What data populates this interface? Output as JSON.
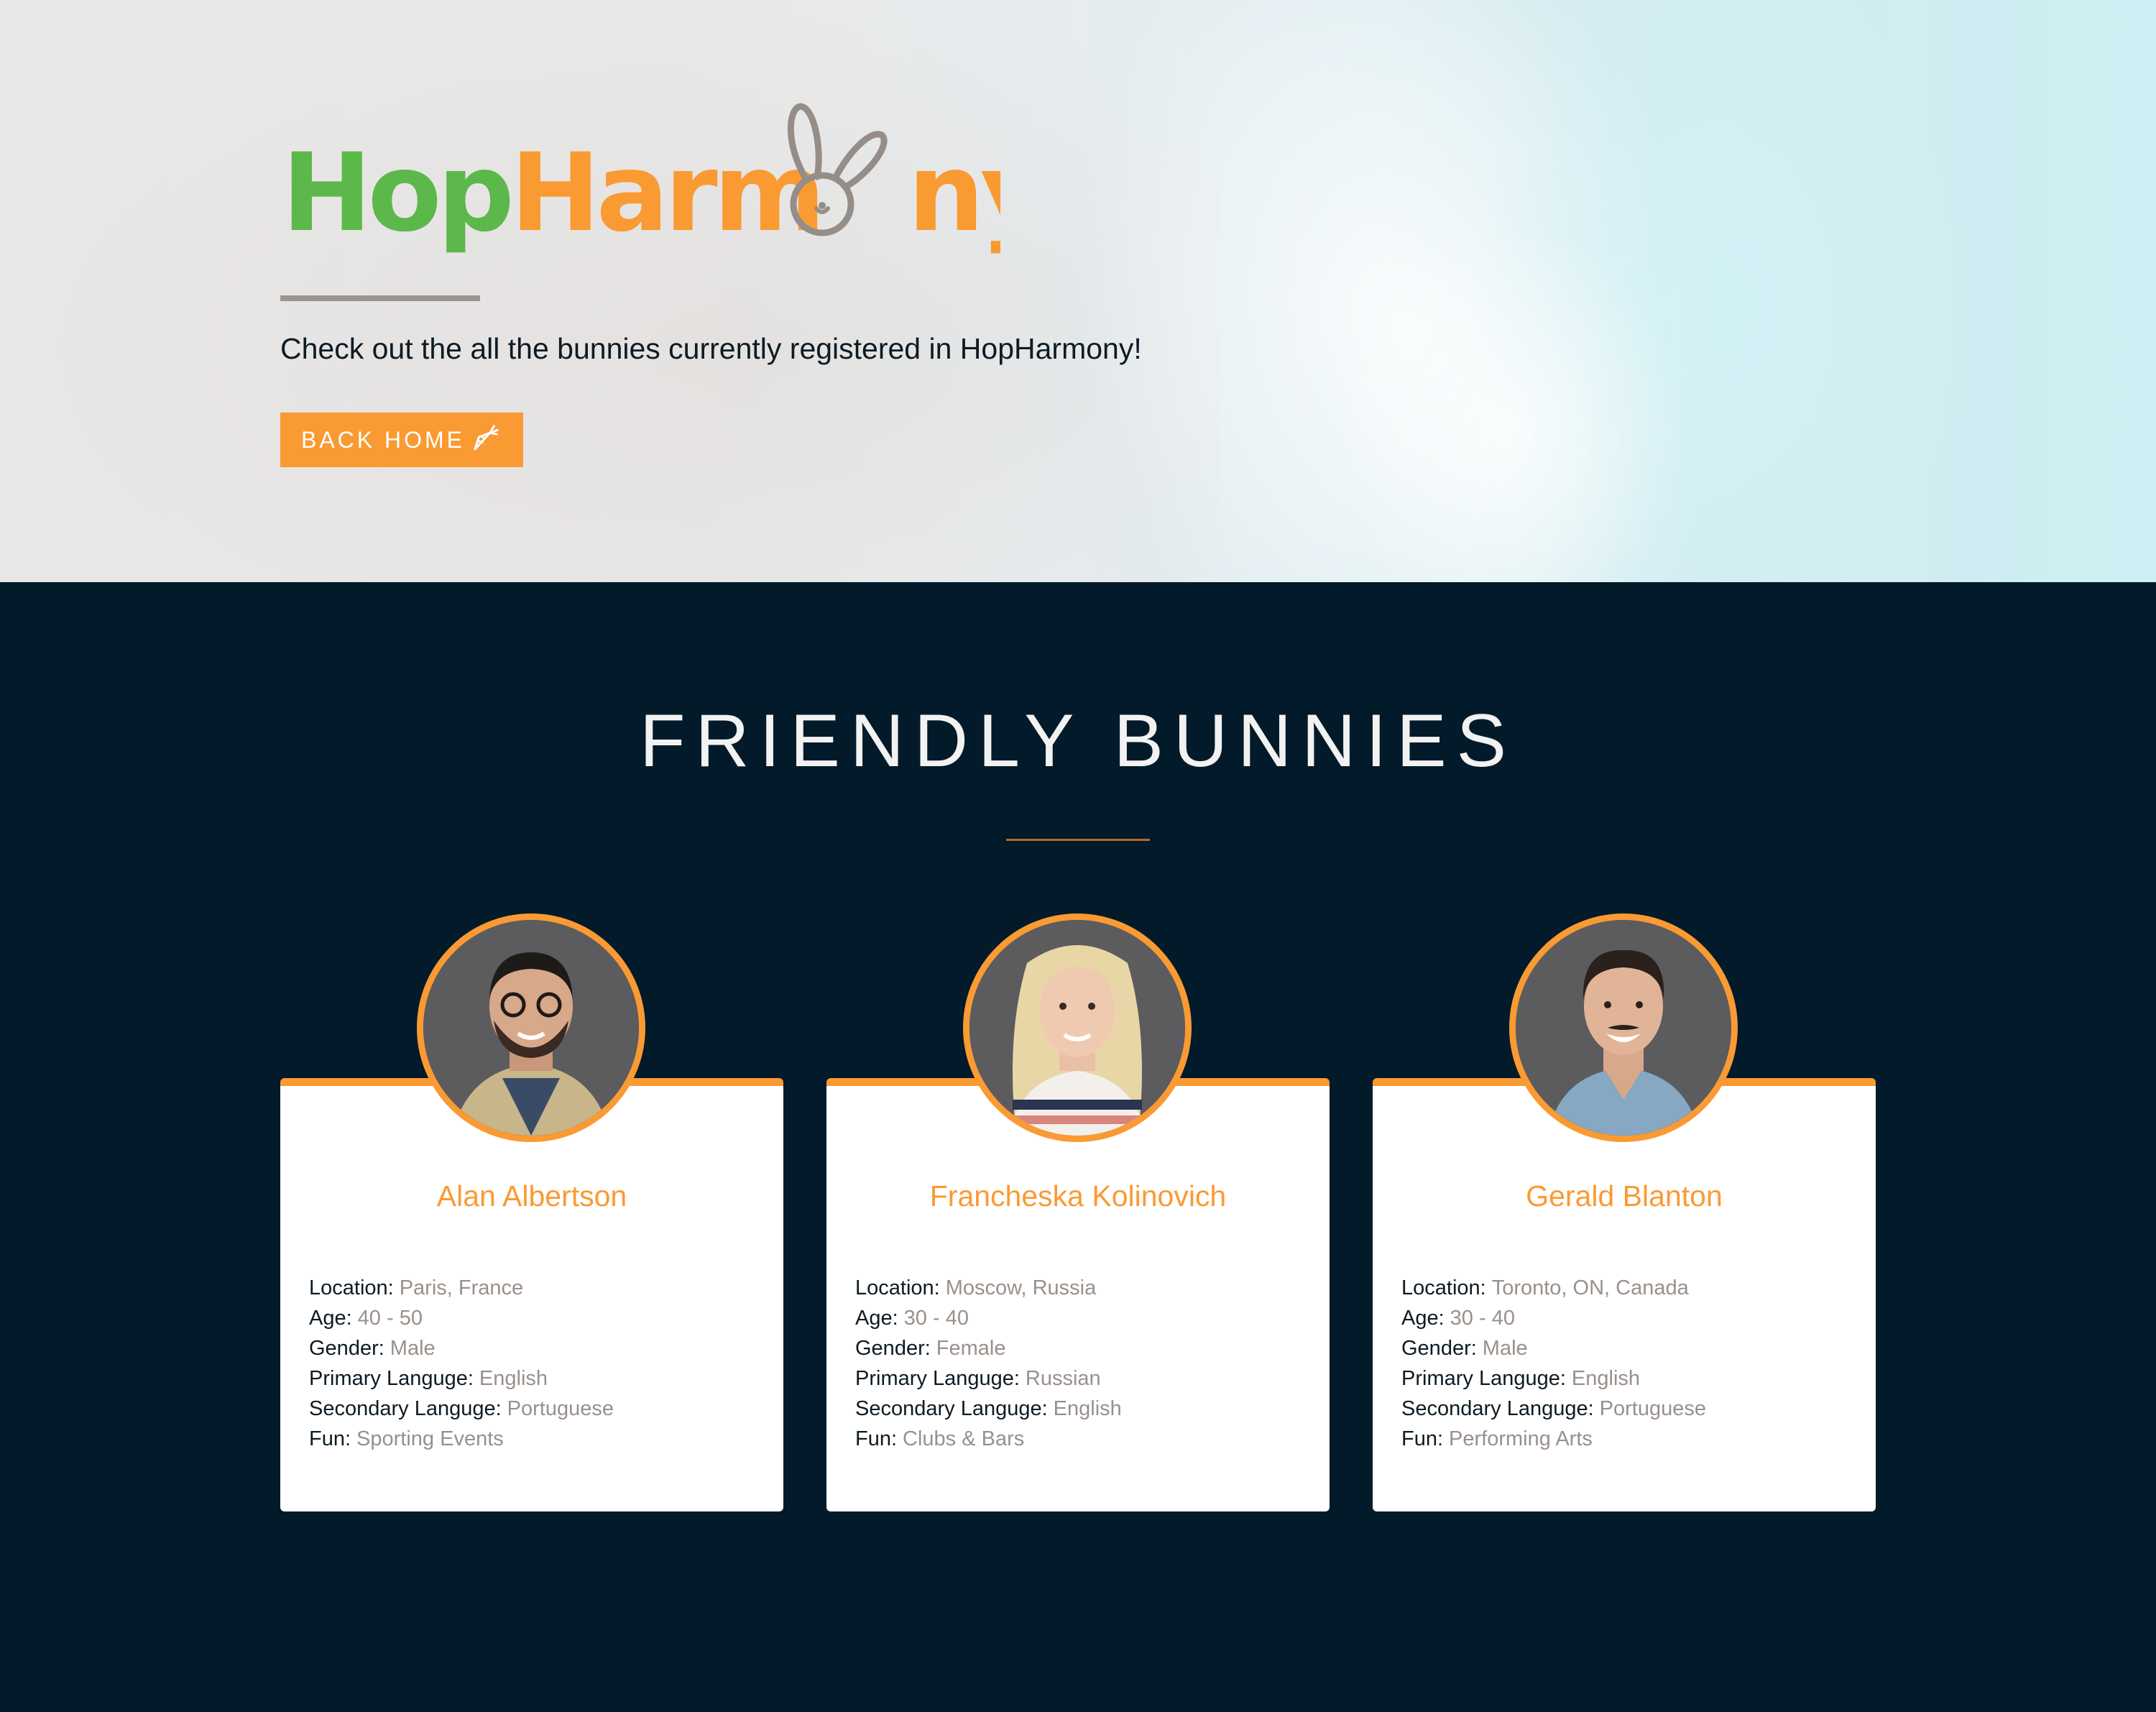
{
  "hero": {
    "logo": {
      "part1": "Hop",
      "part2": "Harm",
      "part3": "ny",
      "icon": "bunny-ears-icon"
    },
    "tagline": "Check out the all the bunnies currently registered in HopHarmony!",
    "back_button": {
      "label": "BACK HOME",
      "icon": "carrot-icon"
    }
  },
  "section": {
    "title": "FRIENDLY BUNNIES"
  },
  "labels": {
    "location": "Location:",
    "age": "Age:",
    "gender": "Gender:",
    "primary_language": "Primary Languge:",
    "secondary_language": "Secondary Languge:",
    "fun": "Fun:"
  },
  "cards": [
    {
      "name": "Alan Albertson",
      "location": "Paris, France",
      "age": "40 - 50",
      "gender": "Male",
      "primary_language": "English",
      "secondary_language": "Portuguese",
      "fun": "Sporting Events"
    },
    {
      "name": "Francheska Kolinovich",
      "location": "Moscow, Russia",
      "age": "30 - 40",
      "gender": "Female",
      "primary_language": "Russian",
      "secondary_language": "English",
      "fun": "Clubs & Bars"
    },
    {
      "name": "Gerald Blanton",
      "location": "Toronto, ON, Canada",
      "age": "30 - 40",
      "gender": "Male",
      "primary_language": "English",
      "secondary_language": "Portuguese",
      "fun": "Performing Arts"
    }
  ],
  "colors": {
    "accent": "#fa9a33",
    "logo_green": "#5cb84a",
    "dark_bg": "#021a29",
    "muted_text": "#9a908b"
  }
}
